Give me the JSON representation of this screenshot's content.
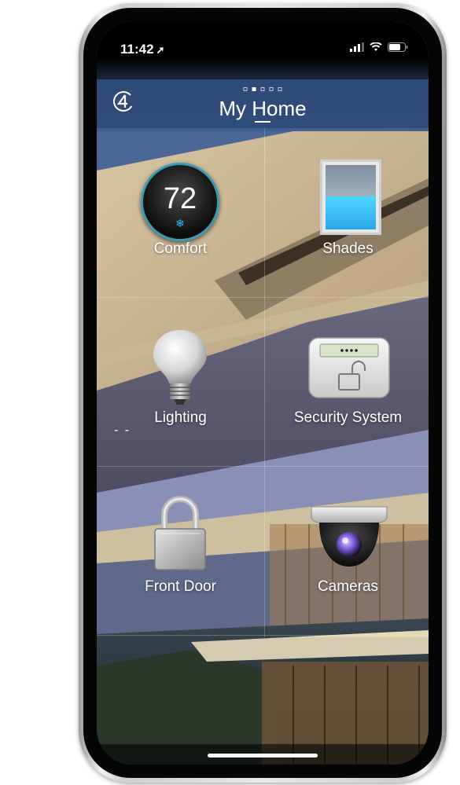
{
  "status_bar": {
    "time": "11:42",
    "location_icon": "location-arrow-icon",
    "icons": [
      "signal-icon",
      "wifi-icon",
      "battery-icon"
    ]
  },
  "header": {
    "title": "My Home",
    "logo_icon": "control4-logo-icon",
    "page_count": 5,
    "active_page": 2
  },
  "tiles": [
    {
      "label": "Comfort",
      "icon": "thermostat-icon",
      "temperature": "72",
      "mode_icon": "snowflake-icon"
    },
    {
      "label": "Shades",
      "icon": "shades-icon"
    },
    {
      "label": "Lighting",
      "icon": "light-bulb-icon"
    },
    {
      "label": "Security System",
      "icon": "security-keypad-icon",
      "keypad_display": "••••"
    },
    {
      "label": "Front Door",
      "icon": "padlock-icon"
    },
    {
      "label": "Cameras",
      "icon": "security-camera-icon"
    }
  ],
  "colors": {
    "thermostat_ring": "#3a9bb5",
    "snowflake": "#39b6ff",
    "shade_open": "#2ba8e8"
  }
}
